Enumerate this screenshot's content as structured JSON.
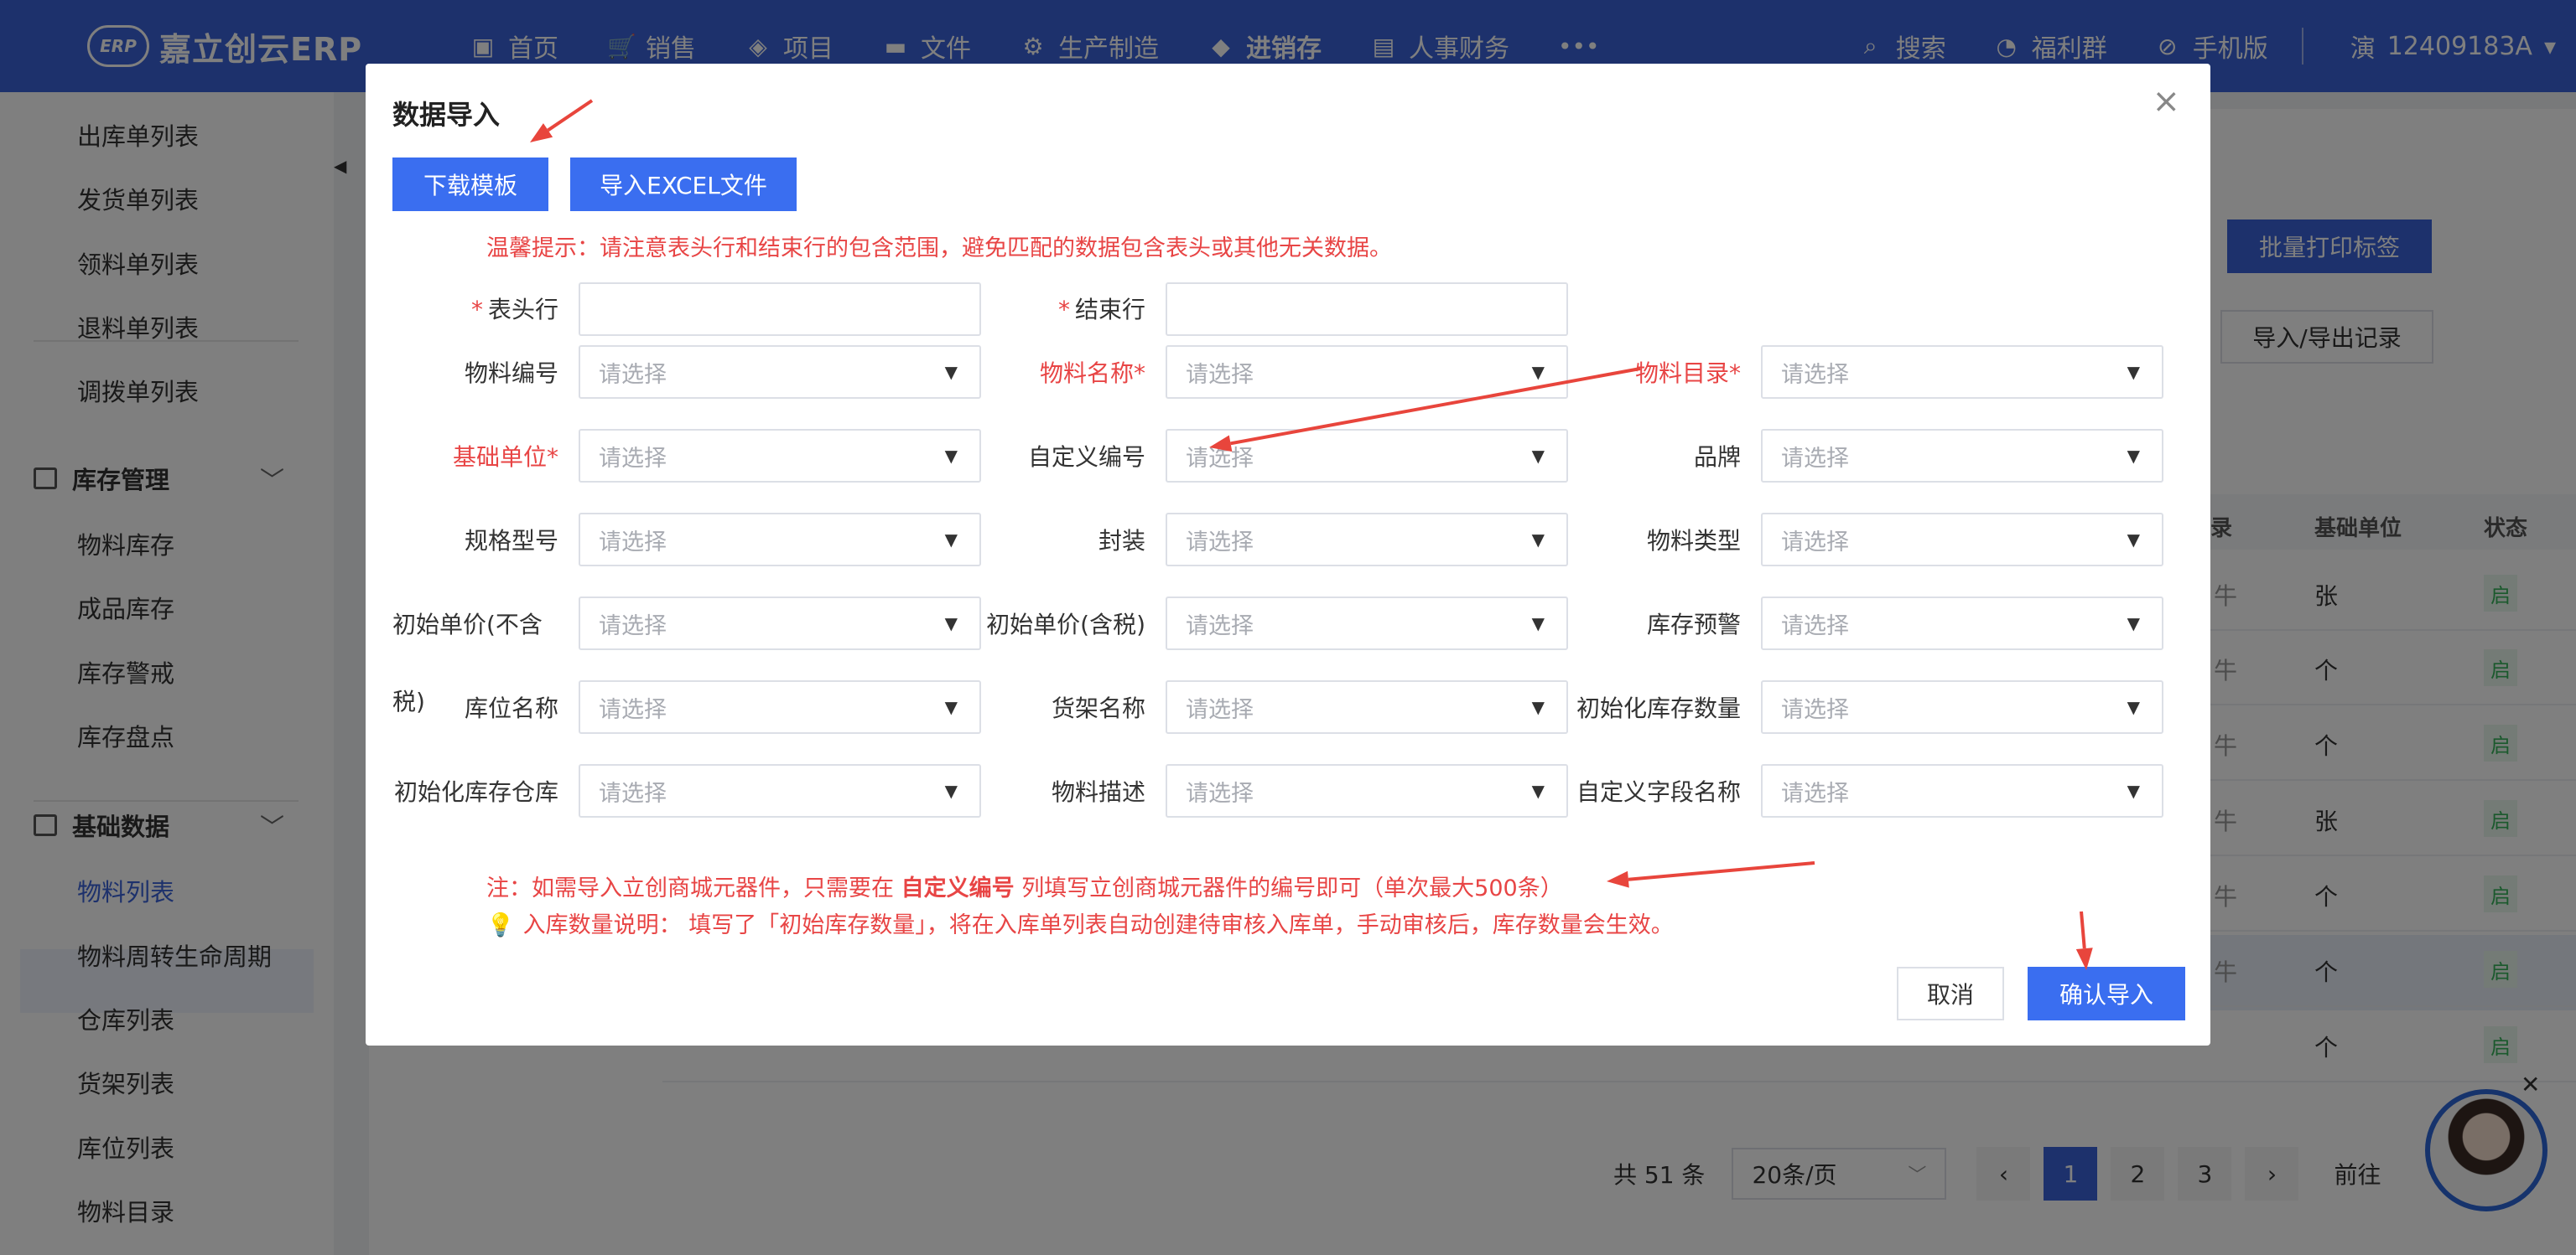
{
  "app": {
    "logo_text": "ERP",
    "brand": "嘉立创云ERP"
  },
  "nav": [
    {
      "icon": "home-icon",
      "glyph": "▣",
      "label": "首页"
    },
    {
      "icon": "cart-icon",
      "glyph": "🛒",
      "label": "销售"
    },
    {
      "icon": "layers-icon",
      "glyph": "◈",
      "label": "项目"
    },
    {
      "icon": "folder-icon",
      "glyph": "▬",
      "label": "文件"
    },
    {
      "icon": "gear-icon",
      "glyph": "⚙",
      "label": "生产制造"
    },
    {
      "icon": "box-icon",
      "glyph": "◆",
      "label": "进销存"
    },
    {
      "icon": "person-card-icon",
      "glyph": "▤",
      "label": "人事财务"
    },
    {
      "icon": "more-icon",
      "glyph": "•••",
      "label": ""
    }
  ],
  "right_nav": {
    "search": "搜索",
    "welfare": "福利群",
    "mobile": "手机版",
    "user_initial": "演",
    "user_id": "12409183A",
    "user_caret": "▾"
  },
  "sidebar": {
    "links_top": [
      "出库单列表",
      "发货单列表",
      "领料单列表",
      "退料单列表",
      "调拨单列表"
    ],
    "group_inventory": "库存管理",
    "links_inventory": [
      "物料库存",
      "成品库存",
      "库存警戒",
      "库存盘点"
    ],
    "group_base": "基础数据",
    "links_base": [
      "物料列表",
      "物料周转生命周期",
      "仓库列表",
      "货架列表",
      "库位列表",
      "物料目录"
    ],
    "chevron": "﹀",
    "collapse": "◀"
  },
  "background": {
    "btn_print": "批量打印标签",
    "btn_record": "导入/导出记录",
    "col_catalog": "录",
    "col_unit": "基础单位",
    "col_status": "状态",
    "row_units": [
      "张",
      "个",
      "个",
      "张",
      "个",
      "个",
      "个"
    ],
    "row_col_left": [
      "牛",
      "牛",
      "牛",
      "牛",
      "牛",
      "牛"
    ],
    "status_label": "启",
    "pager": {
      "total": "共 51 条",
      "page_size": "20条/页",
      "prev": "‹",
      "pages": [
        "1",
        "2",
        "3"
      ],
      "next": "›",
      "goto": "前往"
    },
    "avatar_close": "✕"
  },
  "dialog": {
    "title": "数据导入",
    "close": "×",
    "btn_download": "下载模板",
    "btn_import_excel": "导入EXCEL文件",
    "tip": "温馨提示：请注意表头行和结束行的包含范围，避免匹配的数据包含表头或其他无关数据。",
    "header_row_label": "表头行",
    "end_row_label": "结束行",
    "star": "*",
    "placeholder": "请选择",
    "caret": "▼",
    "fields": [
      {
        "label": "物料编号",
        "required": false
      },
      {
        "label": "物料名称*",
        "required": true
      },
      {
        "label": "物料目录*",
        "required": true
      },
      {
        "label": "基础单位*",
        "required": true
      },
      {
        "label": "自定义编号",
        "required": false
      },
      {
        "label": "品牌",
        "required": false
      },
      {
        "label": "规格型号",
        "required": false
      },
      {
        "label": "封装",
        "required": false
      },
      {
        "label": "物料类型",
        "required": false
      },
      {
        "label": "初始单价(不含",
        "required": false
      },
      {
        "label": "初始单价(含税)",
        "required": false
      },
      {
        "label": "库存预警",
        "required": false
      },
      {
        "label": "库位名称",
        "required": false
      },
      {
        "label": "货架名称",
        "required": false
      },
      {
        "label": "初始化库存数量",
        "required": false
      },
      {
        "label": "初始化库存仓库",
        "required": false
      },
      {
        "label": "物料描述",
        "required": false
      },
      {
        "label": "自定义字段名称",
        "required": false
      }
    ],
    "label_wrap_tail": "税)",
    "note_prefix": "注：如需导入立创商城元器件，只需要在",
    "note_bold": "自定义编号",
    "note_suffix": "列填写立创商城元器件的编号即可（单次最大500条）",
    "note2_bulb": "💡",
    "note2": "入库数量说明： 填写了「初始库存数量」，将在入库单列表自动创建待审核入库单，手动审核后，库存数量会生效。",
    "btn_cancel": "取消",
    "btn_confirm": "确认导入"
  },
  "annotation_color": "#e8453c"
}
